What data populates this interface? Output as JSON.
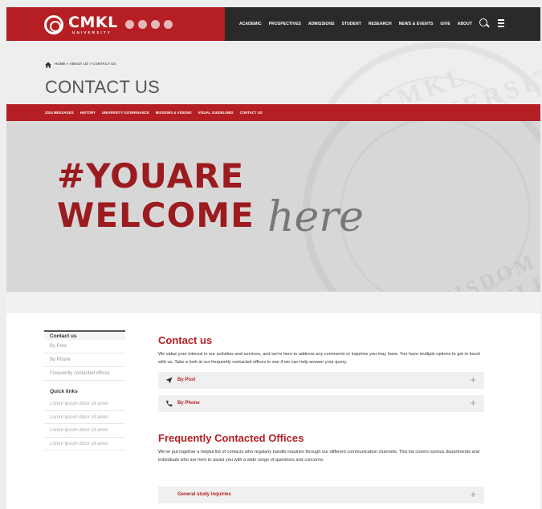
{
  "header": {
    "logo_word": "CMKL",
    "logo_sub": "UNIVERSITY",
    "nav": [
      "ACADEMIC",
      "PROSPECTIVES",
      "ADMISSIONS",
      "STUDENT",
      "RESEARCH",
      "NEWS & EVENTS",
      "GIVE",
      "ABOUT"
    ]
  },
  "breadcrumb": "HOME > ABOUT US > CONTACT US",
  "page_title": "CONTACT US",
  "subnav": [
    "2024 MESSAGES",
    "HISTORY",
    "UNIVERSITY GOVERNANCE",
    "MISSIONS & VISIONS",
    "VISUAL GUIDELINES",
    "CONTACT US"
  ],
  "hero": {
    "line1": "#YOUARE",
    "line2": "WELCOME",
    "script": "here",
    "watermark_top": "CMKL UNIVERSITY",
    "watermark_bottom": "WISDOM & KNOWLEDGE"
  },
  "sidebar": {
    "heading": "Contact us",
    "items": [
      "By Post",
      "By Phone",
      "Frequently contacted offices"
    ],
    "quick_heading": "Quick links",
    "quick_items": [
      "Lorem ipsum dolor sit amet",
      "Lorem ipsum dolor sit amet",
      "Lorem ipsum dolor sit amet",
      "Lorem ipsum dolor sit amet"
    ]
  },
  "main": {
    "contact_heading": "Contact us",
    "contact_text": "We value your interest in our activities and services, and we're here to address any comments or inquiries you may have. You have multiple options to get in touch with us. Take a look at our frequently contacted offices to see if we can help answer your query.",
    "accordions": [
      {
        "label": "By Post",
        "icon": "paper-plane-icon"
      },
      {
        "label": "By Phone",
        "icon": "phone-icon"
      }
    ],
    "offices_heading": "Frequently Contacted Offices",
    "offices_text": "We've put together a helpful list of contacts who regularly handle inquiries through our different communication channels. This list covers various departments and individuals who are here to assist you with a wide range of questions and concerns.",
    "office_items": [
      "General study inquiries"
    ]
  },
  "colors": {
    "brand_red": "#b51f24",
    "dark": "#2a2a2a",
    "hero_bg": "#d7d7d7"
  }
}
